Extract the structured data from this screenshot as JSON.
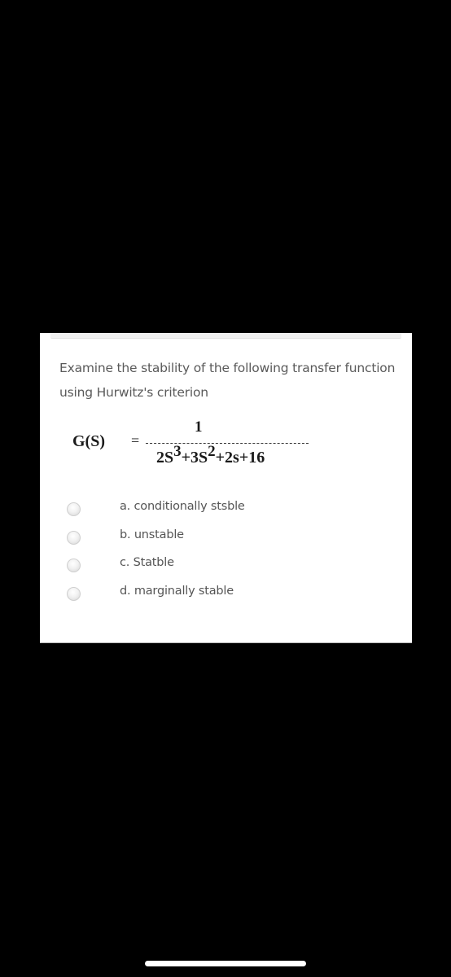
{
  "question": {
    "text": "Examine the stability of the following transfer function  using Hurwitz's criterion"
  },
  "formula": {
    "lhs": "G(S)",
    "equals": "=",
    "numerator": "1",
    "denominator": {
      "t1_base": "2S",
      "t1_exp": "3",
      "t2_base": "+3S",
      "t2_exp": "2",
      "rest": "+2s+16"
    }
  },
  "options": [
    {
      "label": "a. conditionally stsble",
      "selected": false
    },
    {
      "label": "b. unstable",
      "selected": false
    },
    {
      "label": "c. Statble",
      "selected": false
    },
    {
      "label": "d. marginally stable",
      "selected": false
    }
  ],
  "colors": {
    "background": "#000000",
    "card": "#ffffff",
    "question_text": "#5a5a5a",
    "option_text": "#555555",
    "formula_text": "#1a1a1a"
  }
}
